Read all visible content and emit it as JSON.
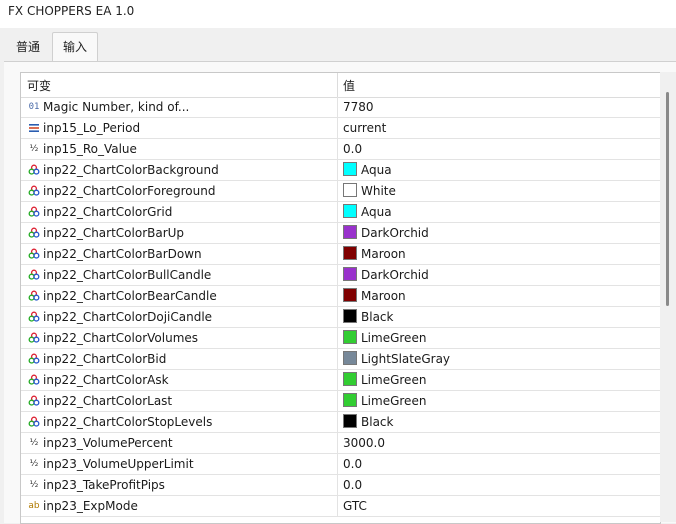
{
  "window": {
    "title": "FX CHOPPERS  EA 1.0"
  },
  "tabs": [
    {
      "label": "普通"
    },
    {
      "label": "输入"
    }
  ],
  "grid": {
    "columns": {
      "name": "可变",
      "value": "值"
    },
    "rows": [
      {
        "icon": "int-icon",
        "icon_glyph": "01",
        "name": "Magic Number, kind of...",
        "value": "7780"
      },
      {
        "icon": "enum-icon",
        "icon_glyph": "",
        "name": "inp15_Lo_Period",
        "value": "current"
      },
      {
        "icon": "fraction-icon",
        "icon_glyph": "½",
        "name": "inp15_Ro_Value",
        "value": "0.0"
      },
      {
        "icon": "color-icon",
        "icon_glyph": "",
        "name": "inp22_ChartColorBackground",
        "value": "Aqua",
        "color": "#00ffff"
      },
      {
        "icon": "color-icon",
        "icon_glyph": "",
        "name": "inp22_ChartColorForeground",
        "value": "White",
        "color": "#ffffff"
      },
      {
        "icon": "color-icon",
        "icon_glyph": "",
        "name": "inp22_ChartColorGrid",
        "value": "Aqua",
        "color": "#00ffff"
      },
      {
        "icon": "color-icon",
        "icon_glyph": "",
        "name": "inp22_ChartColorBarUp",
        "value": "DarkOrchid",
        "color": "#9932cc"
      },
      {
        "icon": "color-icon",
        "icon_glyph": "",
        "name": "inp22_ChartColorBarDown",
        "value": "Maroon",
        "color": "#800000"
      },
      {
        "icon": "color-icon",
        "icon_glyph": "",
        "name": "inp22_ChartColorBullCandle",
        "value": "DarkOrchid",
        "color": "#9932cc"
      },
      {
        "icon": "color-icon",
        "icon_glyph": "",
        "name": "inp22_ChartColorBearCandle",
        "value": "Maroon",
        "color": "#800000"
      },
      {
        "icon": "color-icon",
        "icon_glyph": "",
        "name": "inp22_ChartColorDojiCandle",
        "value": "Black",
        "color": "#000000"
      },
      {
        "icon": "color-icon",
        "icon_glyph": "",
        "name": "inp22_ChartColorVolumes",
        "value": "LimeGreen",
        "color": "#32cd32"
      },
      {
        "icon": "color-icon",
        "icon_glyph": "",
        "name": "inp22_ChartColorBid",
        "value": "LightSlateGray",
        "color": "#778899"
      },
      {
        "icon": "color-icon",
        "icon_glyph": "",
        "name": "inp22_ChartColorAsk",
        "value": "LimeGreen",
        "color": "#32cd32"
      },
      {
        "icon": "color-icon",
        "icon_glyph": "",
        "name": "inp22_ChartColorLast",
        "value": "LimeGreen",
        "color": "#32cd32"
      },
      {
        "icon": "color-icon",
        "icon_glyph": "",
        "name": "inp22_ChartColorStopLevels",
        "value": "Black",
        "color": "#000000"
      },
      {
        "icon": "fraction-icon",
        "icon_glyph": "½",
        "name": "inp23_VolumePercent",
        "value": "3000.0"
      },
      {
        "icon": "fraction-icon",
        "icon_glyph": "½",
        "name": "inp23_VolumeUpperLimit",
        "value": "0.0"
      },
      {
        "icon": "fraction-icon",
        "icon_glyph": "½",
        "name": "inp23_TakeProfitPips",
        "value": "0.0"
      },
      {
        "icon": "string-icon",
        "icon_glyph": "ab",
        "name": "inp23_ExpMode",
        "value": "GTC"
      }
    ]
  }
}
